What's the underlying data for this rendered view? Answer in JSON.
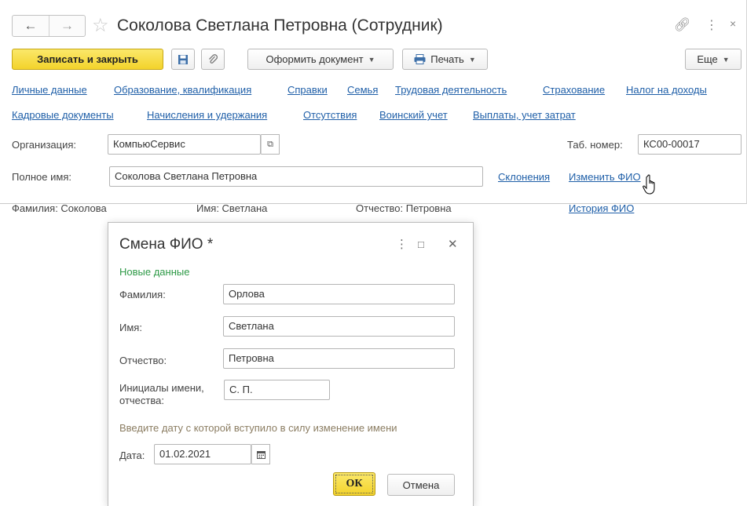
{
  "main": {
    "title": "Соколова Светлана Петровна (Сотрудник)",
    "toolbar": {
      "save_close": "Записать и закрыть",
      "create_doc": "Оформить документ",
      "print": "Печать",
      "more": "Еще"
    },
    "links_row1": [
      "Личные данные",
      "Образование, квалификация",
      "Справки",
      "Семья",
      "Трудовая деятельность",
      "Страхование",
      "Налог на доходы"
    ],
    "links_row2": [
      "Кадровые документы",
      "Начисления и удержания",
      "Отсутствия",
      "Воинский учет",
      "Выплаты, учет затрат"
    ],
    "org_label": "Организация:",
    "org_value": "КомпьюСервис",
    "tab_label": "Таб. номер:",
    "tab_value": "КС00-00017",
    "fullname_label": "Полное имя:",
    "fullname_value": "Соколова Светлана Петровна",
    "declensions_link": "Склонения",
    "change_fio_link": "Изменить ФИО",
    "surname_text": "Фамилия: Соколова",
    "name_text": "Имя: Светлана",
    "patronymic_text": "Отчество: Петровна",
    "history_link": "История ФИО"
  },
  "dialog": {
    "title": "Смена ФИО *",
    "section": "Новые данные",
    "surname_label": "Фамилия:",
    "surname_value": "Орлова",
    "name_label": "Имя:",
    "name_value": "Светлана",
    "patronymic_label": "Отчество:",
    "patronymic_value": "Петровна",
    "initials_label_1": "Инициалы имени,",
    "initials_label_2": "отчества:",
    "initials_value": "С. П.",
    "hint": "Введите дату с которой вступило в силу изменение имени",
    "date_label": "Дата:",
    "date_value": "01.02.2021",
    "ok": "ОК",
    "cancel": "Отмена"
  },
  "colors": {
    "accent": "#f3d32b",
    "link": "#1f5fa8",
    "section": "#2e9a47",
    "hint": "#8b7d62"
  }
}
